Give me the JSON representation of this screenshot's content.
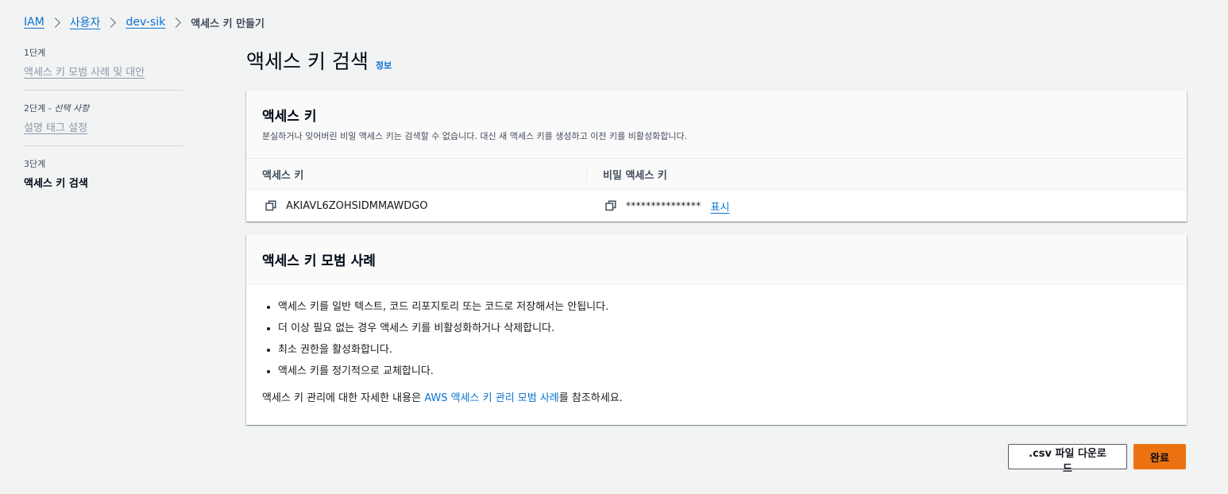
{
  "breadcrumb": {
    "items": [
      "IAM",
      "사용자",
      "dev-sik"
    ],
    "current": "액세스 키 만들기"
  },
  "steps": [
    {
      "num": "1단계",
      "label": "액세스 키 모범 사례 및 대안"
    },
    {
      "num": "2단계",
      "num_suffix": " - ",
      "optional": "선택 사항",
      "label": "설명 태그 설정"
    },
    {
      "num": "3단계",
      "label": "액세스 키 검색"
    }
  ],
  "page": {
    "title": "액세스 키 검색",
    "info": "정보"
  },
  "access_key_card": {
    "title": "액세스 키",
    "description": "분실하거나 잊어버린 비밀 액세스 키는 검색할 수 없습니다. 대신 새 액세스 키를 생성하고 이전 키를 비활성화합니다.",
    "col_access_key": "액세스 키",
    "col_secret_key": "비밀 액세스 키",
    "access_key_value": "AKIAVL6ZOHSIDMMAWDGO",
    "secret_key_masked": "***************",
    "show_label": "표시"
  },
  "best_practices": {
    "title": "액세스 키 모범 사례",
    "items": [
      "액세스 키를 일반 텍스트, 코드 리포지토리 또는 코드로 저장해서는 안됩니다.",
      "더 이상 필요 없는 경우 액세스 키를 비활성화하거나 삭제합니다.",
      "최소 권한을 활성화합니다.",
      "액세스 키를 정기적으로 교체합니다."
    ],
    "footer_prefix": "액세스 키 관리에 대한 자세한 내용은 ",
    "footer_link": "AWS 액세스 키 관리 모범 사례",
    "footer_suffix": "를 참조하세요."
  },
  "actions": {
    "download_csv": ".csv 파일 다운로드",
    "done": "완료"
  },
  "colors": {
    "link": "#0972d3",
    "primary": "#ec7211",
    "background": "#f2f3f3"
  }
}
